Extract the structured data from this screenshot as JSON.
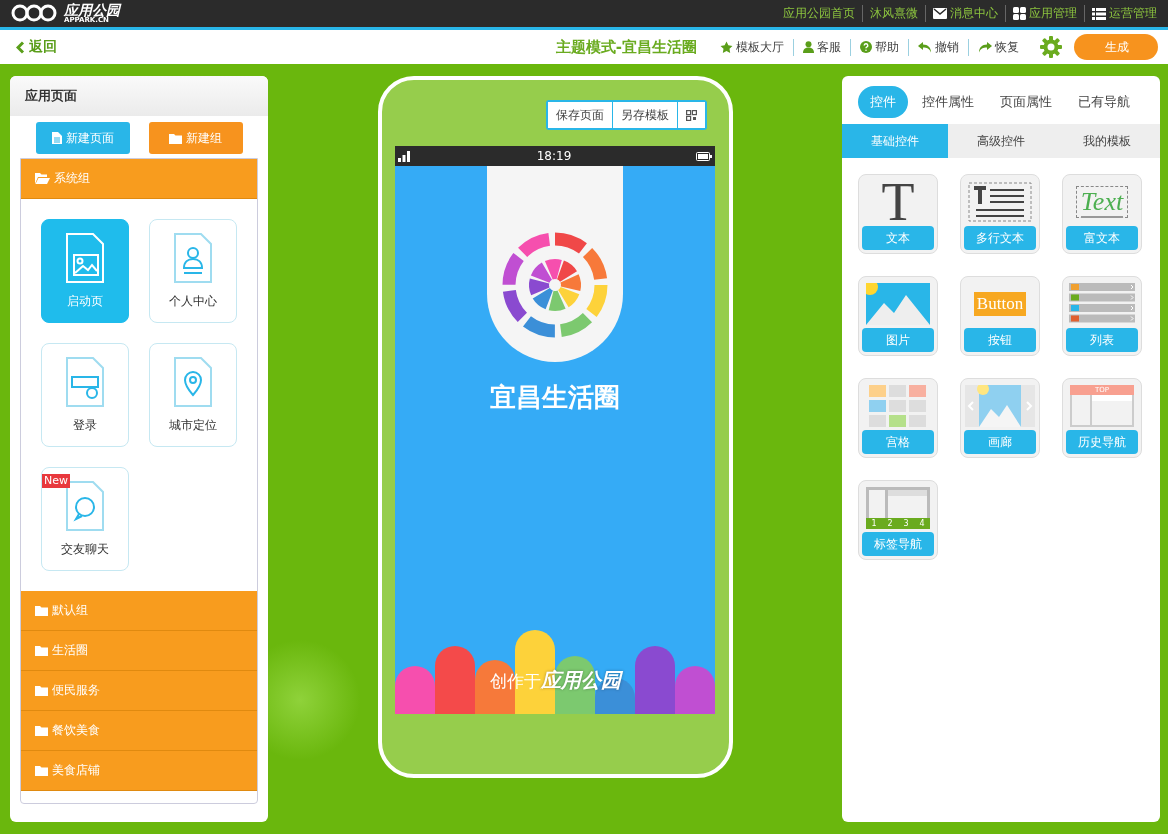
{
  "top_bar": {
    "logo": {
      "name": "应用公园",
      "domain": "APPARK.CN"
    },
    "links": [
      {
        "label": "应用公园首页",
        "kind": "plain"
      },
      {
        "label": "沐风熹微",
        "kind": "plain"
      },
      {
        "label": "消息中心",
        "kind": "mail"
      },
      {
        "label": "应用管理",
        "kind": "grid"
      },
      {
        "label": "运营管理",
        "kind": "list"
      }
    ]
  },
  "toolbar": {
    "back": "返回",
    "title": "主题模式-宜昌生活圈",
    "actions": [
      {
        "label": "模板大厅",
        "kind": "star"
      },
      {
        "label": "客服",
        "kind": "user"
      },
      {
        "label": "帮助",
        "kind": "help"
      },
      {
        "label": "撤销",
        "kind": "undo"
      },
      {
        "label": "恢复",
        "kind": "redo"
      }
    ],
    "generate": "生成"
  },
  "left_panel": {
    "title": "应用页面",
    "buttons": [
      {
        "label": "新建页面",
        "kind": "page"
      },
      {
        "label": "新建组",
        "kind": "group"
      }
    ],
    "groups": [
      {
        "name": "系统组",
        "expanded": true,
        "pages": [
          {
            "label": "启动页",
            "kind": "start",
            "selected": true
          },
          {
            "label": "个人中心",
            "kind": "user",
            "selected": false
          },
          {
            "label": "登录",
            "kind": "login",
            "selected": false
          },
          {
            "label": "城市定位",
            "kind": "location",
            "selected": false
          },
          {
            "label": "交友聊天",
            "kind": "chat",
            "selected": false,
            "badge": "New"
          }
        ]
      },
      {
        "name": "默认组",
        "expanded": false
      },
      {
        "name": "生活圈",
        "expanded": false
      },
      {
        "name": "便民服务",
        "expanded": false
      },
      {
        "name": "餐饮美食",
        "expanded": false
      },
      {
        "name": "美食店铺",
        "expanded": false
      }
    ]
  },
  "phone": {
    "buttons": [
      "保存页面",
      "另存模板"
    ],
    "time": "18:19",
    "splash_title": "宜昌生活圈",
    "credit": "创作于",
    "brand": "应用公园"
  },
  "right_panel": {
    "tabs": [
      {
        "label": "控件",
        "selected": true
      },
      {
        "label": "控件属性",
        "selected": false
      },
      {
        "label": "页面属性",
        "selected": false
      },
      {
        "label": "已有导航",
        "selected": false
      }
    ],
    "subtabs": [
      {
        "label": "基础控件",
        "selected": true
      },
      {
        "label": "高级控件",
        "selected": false
      },
      {
        "label": "我的模板",
        "selected": false
      }
    ],
    "widgets": [
      {
        "label": "文本",
        "kind": "text",
        "sample": "T"
      },
      {
        "label": "多行文本",
        "kind": "multiline"
      },
      {
        "label": "富文本",
        "kind": "rich",
        "sample": "Text"
      },
      {
        "label": "图片",
        "kind": "image"
      },
      {
        "label": "按钮",
        "kind": "button",
        "sample": "Button"
      },
      {
        "label": "列表",
        "kind": "list"
      },
      {
        "label": "宫格",
        "kind": "grid"
      },
      {
        "label": "画廊",
        "kind": "gallery"
      },
      {
        "label": "历史导航",
        "kind": "history",
        "sample": "TOP"
      },
      {
        "label": "标签导航",
        "kind": "tabs",
        "digits": [
          "1",
          "2",
          "3",
          "4"
        ]
      }
    ]
  }
}
